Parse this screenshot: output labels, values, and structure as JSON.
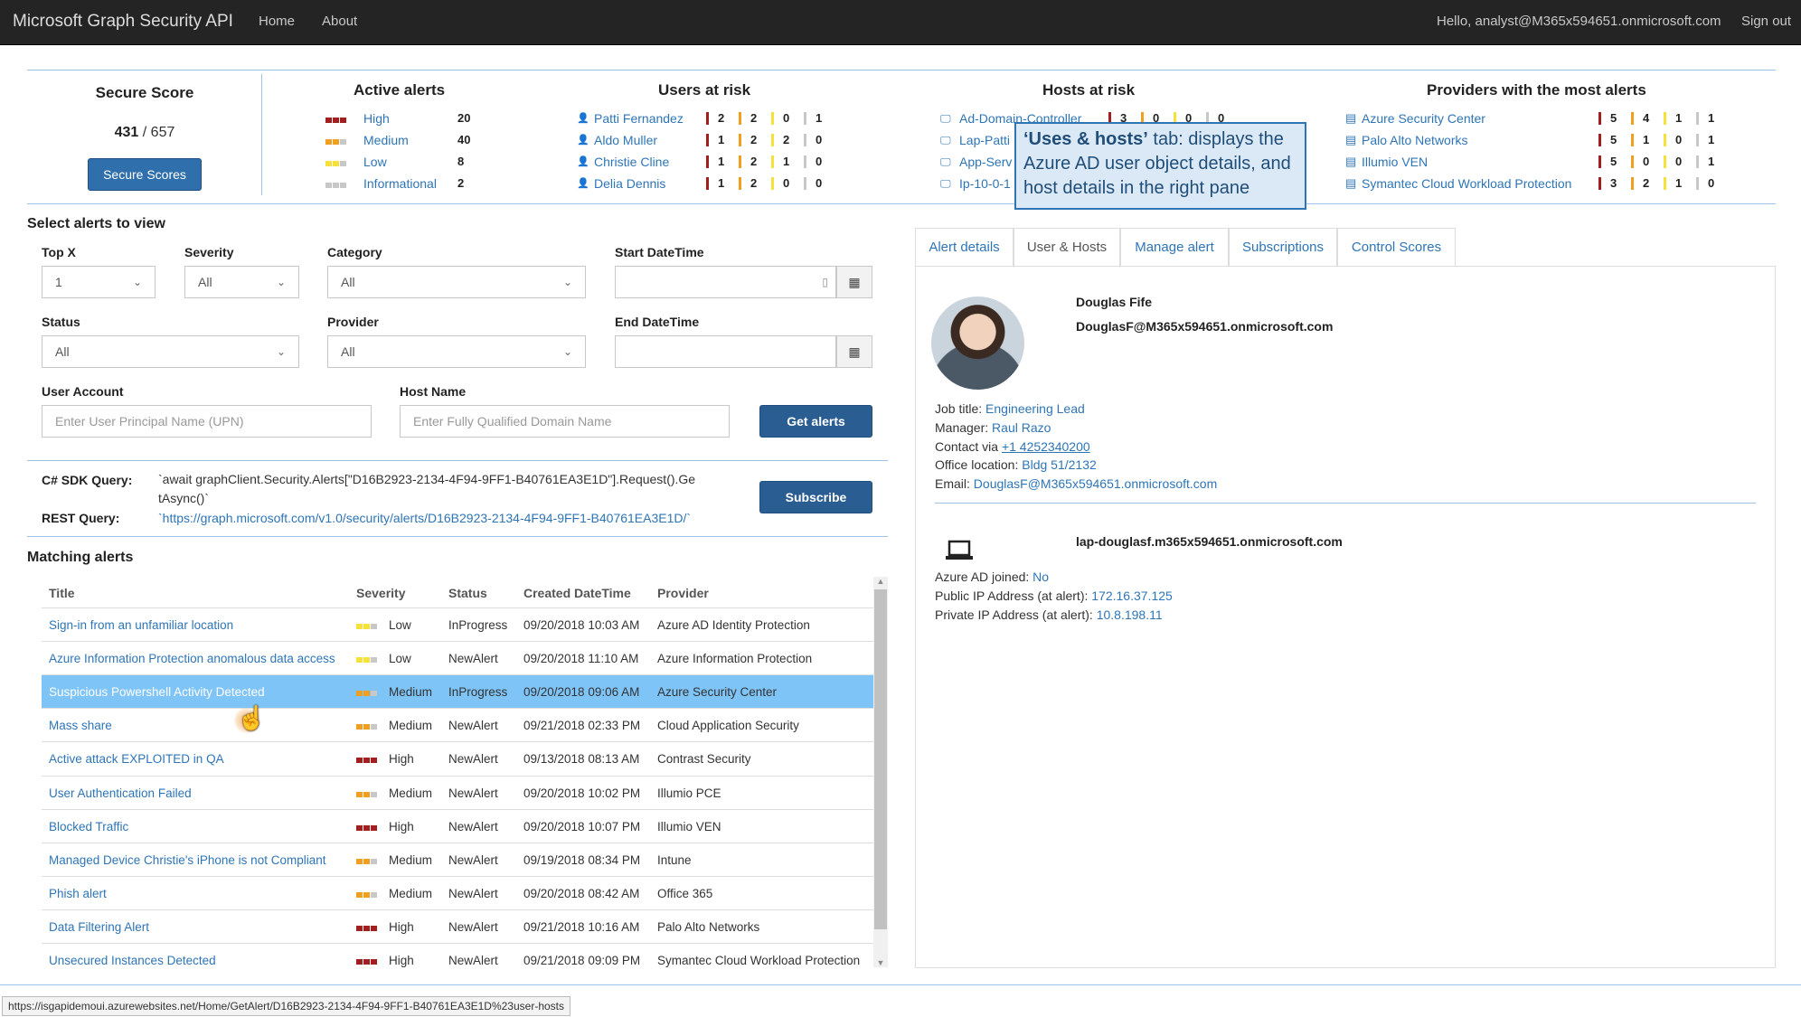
{
  "nav": {
    "brand": "Microsoft Graph Security API",
    "home": "Home",
    "about": "About",
    "greeting": "Hello, analyst@M365x594651.onmicrosoft.com",
    "signout": "Sign out"
  },
  "secure_score": {
    "title": "Secure Score",
    "current": "431",
    "sep": " / ",
    "max": "657",
    "button": "Secure Scores"
  },
  "active_alerts": {
    "title": "Active alerts",
    "rows": [
      {
        "label": "High",
        "count": "20"
      },
      {
        "label": "Medium",
        "count": "40"
      },
      {
        "label": "Low",
        "count": "8"
      },
      {
        "label": "Informational",
        "count": "2"
      }
    ]
  },
  "users_at_risk": {
    "title": "Users at risk",
    "rows": [
      {
        "name": "Patti Fernandez",
        "h": "2",
        "m": "2",
        "l": "0",
        "i": "1"
      },
      {
        "name": "Aldo Muller",
        "h": "1",
        "m": "2",
        "l": "2",
        "i": "0"
      },
      {
        "name": "Christie Cline",
        "h": "1",
        "m": "2",
        "l": "1",
        "i": "0"
      },
      {
        "name": "Delia Dennis",
        "h": "1",
        "m": "2",
        "l": "0",
        "i": "0"
      }
    ]
  },
  "hosts_at_risk": {
    "title": "Hosts at risk",
    "rows": [
      {
        "name": "Ad-Domain-Controller",
        "h": "3",
        "m": "0",
        "l": "0",
        "i": "0"
      },
      {
        "name": "Lap-Patti"
      },
      {
        "name": "App-Serv"
      },
      {
        "name": "Ip-10-0-1"
      }
    ]
  },
  "providers": {
    "title": "Providers with the most alerts",
    "rows": [
      {
        "name": "Azure Security Center",
        "h": "5",
        "m": "4",
        "l": "1",
        "i": "1"
      },
      {
        "name": "Palo Alto Networks",
        "h": "5",
        "m": "1",
        "l": "0",
        "i": "1"
      },
      {
        "name": "Illumio VEN",
        "h": "5",
        "m": "0",
        "l": "0",
        "i": "1"
      },
      {
        "name": "Symantec Cloud Workload Protection",
        "h": "3",
        "m": "2",
        "l": "1",
        "i": "0"
      }
    ]
  },
  "callout": {
    "bold": "‘Uses & hosts’",
    "text": " tab: displays the Azure AD user object details, and host details in the right pane"
  },
  "filters": {
    "title": "Select alerts to view",
    "topx": {
      "label": "Top X",
      "value": "1"
    },
    "severity": {
      "label": "Severity",
      "value": "All"
    },
    "category": {
      "label": "Category",
      "value": "All"
    },
    "start": {
      "label": "Start DateTime"
    },
    "status": {
      "label": "Status",
      "value": "All"
    },
    "provider": {
      "label": "Provider",
      "value": "All"
    },
    "end": {
      "label": "End DateTime"
    },
    "user": {
      "label": "User Account",
      "placeholder": "Enter User Principal Name (UPN)"
    },
    "host": {
      "label": "Host Name",
      "placeholder": "Enter Fully Qualified Domain Name"
    },
    "get_alerts": "Get alerts"
  },
  "query": {
    "sdk_label": "C# SDK Query:",
    "sdk_line1": "`await graphClient.Security.Alerts[\"D16B2923-2134-4F94-9FF1-B40761EA3E1D\"].Request().Ge",
    "sdk_line2": "tAsync()`",
    "rest_label": "REST Query:",
    "rest_url": "`https://graph.microsoft.com/v1.0/security/alerts/D16B2923-2134-4F94-9FF1-B40761EA3E1D/`",
    "subscribe": "Subscribe"
  },
  "matching": {
    "title": "Matching alerts",
    "headers": [
      "Title",
      "Severity",
      "Status",
      "Created DateTime",
      "Provider"
    ],
    "rows": [
      {
        "title": "Sign-in from an unfamiliar location",
        "severity": "Low",
        "status": "InProgress",
        "created": "09/20/2018 10:03 AM",
        "provider": "Azure AD Identity Protection"
      },
      {
        "title": "Azure Information Protection anomalous data access",
        "severity": "Low",
        "status": "NewAlert",
        "created": "09/20/2018 11:10 AM",
        "provider": "Azure Information Protection"
      },
      {
        "title": "Suspicious Powershell Activity Detected",
        "severity": "Medium",
        "status": "InProgress",
        "created": "09/20/2018 09:06 AM",
        "provider": "Azure Security Center",
        "selected": true
      },
      {
        "title": "Mass share",
        "severity": "Medium",
        "status": "NewAlert",
        "created": "09/21/2018 02:33 PM",
        "provider": "Cloud Application Security"
      },
      {
        "title": "Active attack EXPLOITED in QA",
        "severity": "High",
        "status": "NewAlert",
        "created": "09/13/2018 08:13 AM",
        "provider": "Contrast Security"
      },
      {
        "title": "User Authentication Failed",
        "severity": "Medium",
        "status": "NewAlert",
        "created": "09/20/2018 10:02 PM",
        "provider": "Illumio PCE"
      },
      {
        "title": "Blocked Traffic",
        "severity": "High",
        "status": "NewAlert",
        "created": "09/20/2018 10:07 PM",
        "provider": "Illumio VEN"
      },
      {
        "title": "Managed Device Christie's iPhone is not Compliant",
        "severity": "Medium",
        "status": "NewAlert",
        "created": "09/19/2018 08:34 PM",
        "provider": "Intune"
      },
      {
        "title": "Phish alert",
        "severity": "Medium",
        "status": "NewAlert",
        "created": "09/20/2018 08:42 AM",
        "provider": "Office 365"
      },
      {
        "title": "Data Filtering Alert",
        "severity": "High",
        "status": "NewAlert",
        "created": "09/21/2018 10:16 AM",
        "provider": "Palo Alto Networks"
      },
      {
        "title": "Unsecured Instances Detected",
        "severity": "High",
        "status": "NewAlert",
        "created": "09/21/2018 09:09 PM",
        "provider": "Symantec Cloud Workload Protection"
      }
    ]
  },
  "tabs": [
    "Alert details",
    "User & Hosts",
    "Manage alert",
    "Subscriptions",
    "Control Scores"
  ],
  "user": {
    "name": "Douglas Fife",
    "upn": "DouglasF@M365x594651.onmicrosoft.com",
    "job_label": "Job title: ",
    "job": "Engineering Lead",
    "manager_label": "Manager: ",
    "manager": "Raul Razo",
    "contact_label": "Contact via ",
    "contact": "+1 4252340200",
    "office_label": "Office location: ",
    "office": "Bldg 51/2132",
    "email_label": "Email: ",
    "email": "DouglasF@M365x594651.onmicrosoft.com"
  },
  "host": {
    "fqdn": "lap-douglasf.m365x594651.onmicrosoft.com",
    "aad_label": "Azure AD joined: ",
    "aad": "No",
    "pub_label": "Public IP Address (at alert): ",
    "pub": "172.16.37.125",
    "priv_label": "Private IP Address (at alert): ",
    "priv": "10.8.198.11"
  },
  "statusbar": "https://isgapidemoui.azurewebsites.net/Home/GetAlert/D16B2923-2134-4F94-9FF1-B40761EA3E1D%23user-hosts",
  "colors": {
    "high": "#a31f1f",
    "medium": "#f0a020",
    "low": "#f6e03a",
    "info": "#c8c8c8",
    "link": "#2e75b6",
    "selected_row": "#7fc4f7"
  }
}
